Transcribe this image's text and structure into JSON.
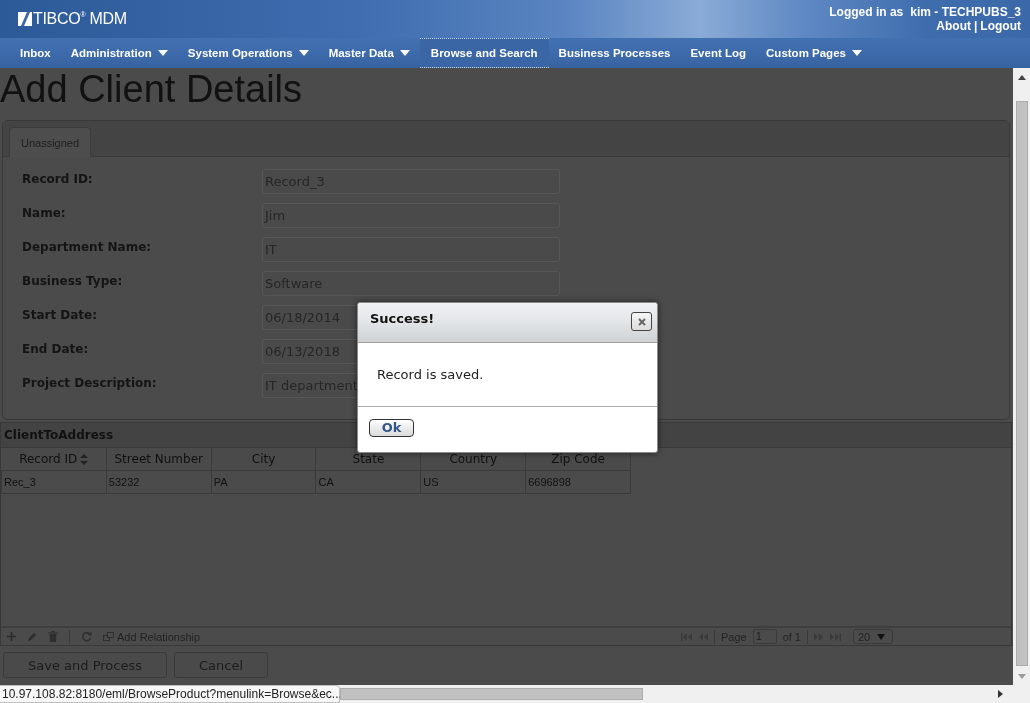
{
  "header": {
    "logo": "TIBCO$^{®}$ MDM",
    "logged_in_label": "Logged in as",
    "user": "kim - TECHPUBS_3",
    "links": [
      {
        "label": "About"
      },
      {
        "label": "Logout"
      }
    ],
    "link_separator": "|"
  },
  "nav": [
    {
      "label": "Inbox",
      "dropdown": false,
      "selected": false
    },
    {
      "label": "Administration",
      "dropdown": true,
      "selected": false
    },
    {
      "label": "System Operations",
      "dropdown": true,
      "selected": false
    },
    {
      "label": "Master Data",
      "dropdown": true,
      "selected": false
    },
    {
      "label": "Browse and Search",
      "dropdown": false,
      "selected": true
    },
    {
      "label": "Business Processes",
      "dropdown": false,
      "selected": false
    },
    {
      "label": "Event Log",
      "dropdown": false,
      "selected": false
    },
    {
      "label": "Custom Pages",
      "dropdown": true,
      "selected": false
    }
  ],
  "page_title": "Add Client Details",
  "tabs": [
    {
      "label": "Unassigned",
      "selected": true
    }
  ],
  "fields": [
    {
      "label": "Record ID:",
      "value": "Record_3"
    },
    {
      "label": "Name:",
      "value": "Jim"
    },
    {
      "label": "Department Name:",
      "value": "IT"
    },
    {
      "label": "Business Type:",
      "value": "Software"
    },
    {
      "label": "Start Date:",
      "value": "06/18/2014"
    },
    {
      "label": "End Date:",
      "value": "06/13/2018"
    },
    {
      "label": "Project Description:",
      "value": "IT department"
    }
  ],
  "relationship": {
    "title": "ClientToAddress",
    "columns": [
      {
        "label": "Record ID",
        "sorted": true
      },
      {
        "label": "Street Number",
        "sorted": false
      },
      {
        "label": "City",
        "sorted": false
      },
      {
        "label": "State",
        "sorted": false
      },
      {
        "label": "Country",
        "sorted": false
      },
      {
        "label": "Zip Code",
        "sorted": false
      }
    ],
    "rows": [
      [
        "Rec_3",
        "53232",
        "PA",
        "CA",
        "US",
        "6696898"
      ]
    ],
    "add_label": "Add Relationship",
    "pager": {
      "page_label": "Page",
      "page": "1",
      "of_label": "of 1",
      "page_size": "20"
    }
  },
  "actions": [
    {
      "label": "Save and Process"
    },
    {
      "label": "Cancel"
    }
  ],
  "status_url": "10.97.108.82:8180/eml/BrowseProduct?menulink=Browse&ec...",
  "dialog": {
    "title": "Success!",
    "message": "Record is saved.",
    "buttons": [
      {
        "label": "Ok"
      }
    ]
  }
}
